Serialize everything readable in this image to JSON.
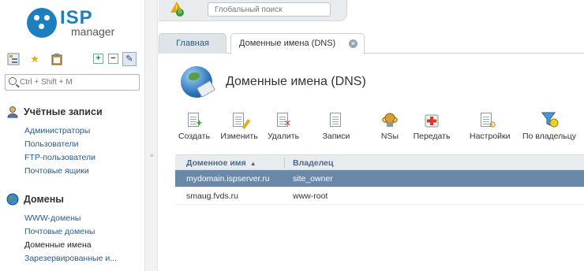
{
  "brand": {
    "logo_top": "ISP",
    "logo_bottom": "manager"
  },
  "topbar": {
    "alert_count": "0",
    "search_placeholder": "Глобальный поиск"
  },
  "sidebar": {
    "search_placeholder": "Ctrl + Shift + M",
    "groups": [
      {
        "title": "Учётные записи",
        "icon": "user-accounts-icon",
        "items": [
          "Администраторы",
          "Пользователи",
          "FTP-пользователи",
          "Почтовые ящики"
        ]
      },
      {
        "title": "Домены",
        "icon": "globe-icon",
        "items": [
          "WWW-домены",
          "Почтовые домены",
          "Доменные имена",
          "Зарезервированные и..."
        ],
        "active_index": 2
      }
    ]
  },
  "tabs": [
    {
      "label": "Главная"
    },
    {
      "label": "Доменные имена (DNS)",
      "active": true
    }
  ],
  "page": {
    "title": "Доменные имена (DNS)"
  },
  "toolbar": [
    {
      "label": "Создать",
      "icon": "create-icon"
    },
    {
      "label": "Изменить",
      "icon": "edit-icon"
    },
    {
      "label": "Удалить",
      "icon": "delete-icon"
    },
    {
      "label": "Записи",
      "icon": "records-icon"
    },
    {
      "label": "NSы",
      "icon": "nameservers-icon"
    },
    {
      "label": "Передать",
      "icon": "transfer-icon"
    },
    {
      "label": "Настройки",
      "icon": "settings-icon"
    },
    {
      "label": "По владельцу",
      "icon": "filter-owner-icon"
    }
  ],
  "table": {
    "columns": [
      "Доменное имя",
      "Владелец"
    ],
    "sort_indicator": "▲",
    "rows": [
      {
        "domain": "mydomain.ispserver.ru",
        "owner": "site_owner",
        "selected": true
      },
      {
        "domain": "smaug.fvds.ru",
        "owner": "www-root",
        "selected": false
      }
    ]
  },
  "colors": {
    "brand_blue": "#1e7fc0",
    "selected_row": "#6a89a8",
    "link": "#2a5a85"
  }
}
